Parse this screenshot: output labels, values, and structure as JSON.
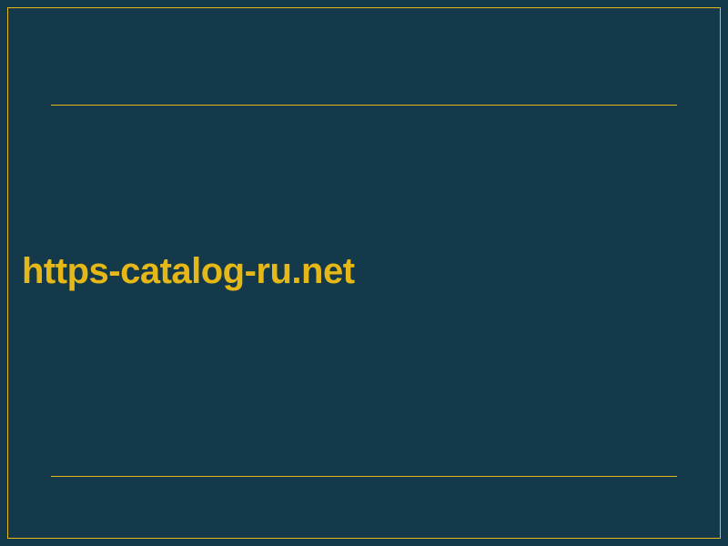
{
  "domain": "https-catalog-ru.net",
  "colors": {
    "background": "#13394a",
    "accent": "#e5b817"
  }
}
